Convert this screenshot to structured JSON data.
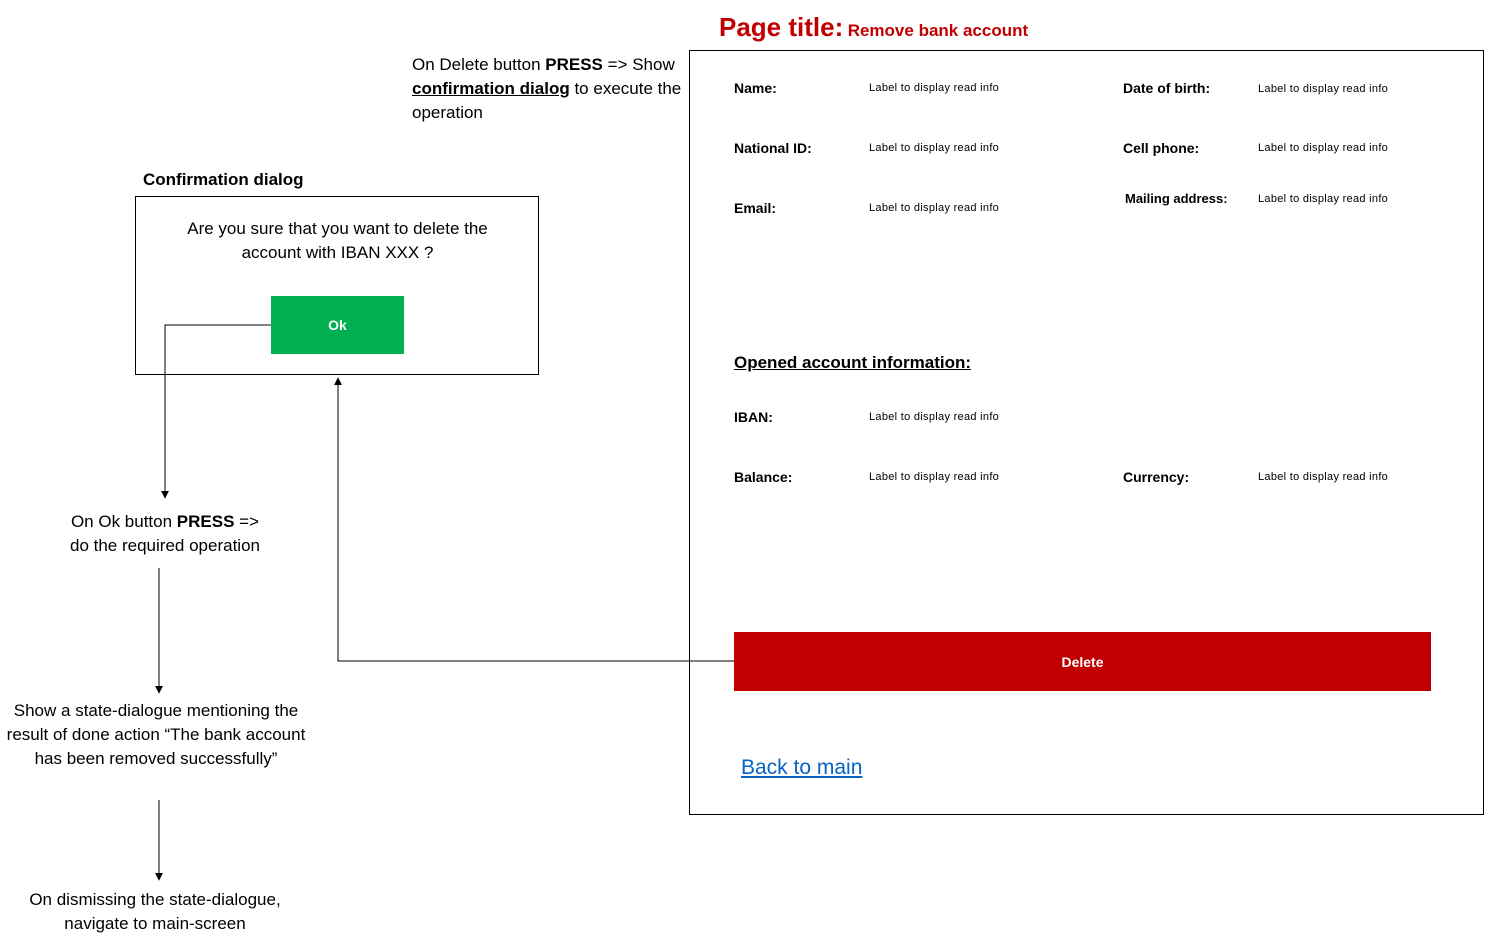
{
  "page_title": {
    "prefix": "Page title:",
    "name": "Remove bank account"
  },
  "notes": {
    "delete_press": {
      "t1": "On Delete button ",
      "t2": "PRESS",
      "t3": " => Show ",
      "t4": "confirmation dialog",
      "t5": " to execute the operation"
    },
    "ok_press": {
      "t1": "On Ok button ",
      "t2": "PRESS",
      "t3": " =>",
      "t4": "do the required operation"
    },
    "state_dialogue": "Show a state-dialogue mentioning the result of done action “The bank account has been removed successfully”",
    "dismiss": "On dismissing the state-dialogue, navigate to main-screen"
  },
  "dialog": {
    "heading": "Confirmation dialog",
    "message": "Are you sure that you want to delete the account with IBAN XXX ?",
    "ok_label": "Ok"
  },
  "screen": {
    "fields": {
      "name": {
        "label": "Name:",
        "value": "Label to display read info"
      },
      "dob": {
        "label": "Date of birth:",
        "value": "Label to display read info"
      },
      "national_id": {
        "label": "National ID:",
        "value": "Label to display read info"
      },
      "cell_phone": {
        "label": "Cell phone:",
        "value": "Label to display read info"
      },
      "email": {
        "label": "Email:",
        "value": "Label to display read info"
      },
      "mailing_address": {
        "label": "Mailing address:",
        "value": "Label to display read info"
      }
    },
    "account_section": {
      "heading": "Opened account information:",
      "iban": {
        "label": "IBAN:",
        "value": "Label to display read info"
      },
      "balance": {
        "label": "Balance:",
        "value": "Label to display read info"
      },
      "currency": {
        "label": "Currency:",
        "value": "Label to display read info"
      }
    },
    "delete_label": "Delete",
    "back_link": "Back to main"
  },
  "colors": {
    "title": "#c00000",
    "ok_button": "#00b050",
    "delete_button": "#c00000",
    "link": "#0563c1"
  }
}
